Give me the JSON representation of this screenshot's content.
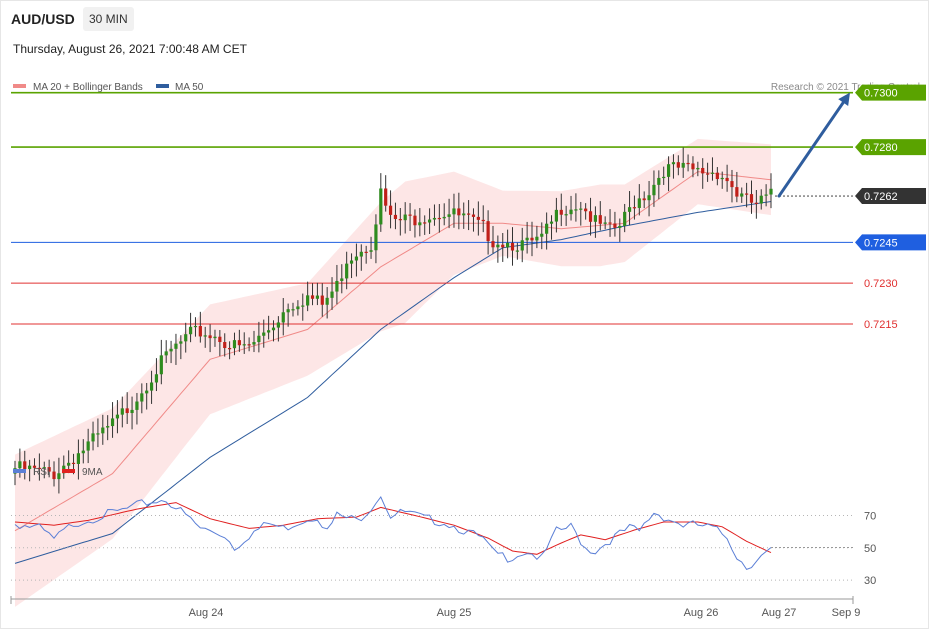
{
  "header": {
    "symbol": "AUD/USD",
    "timeframe": "30 MIN",
    "datetime": "Thursday, August 26, 2021 7:00:48 AM CET",
    "credit": "Research © 2021 Trading Central"
  },
  "legend_main": [
    {
      "label": "MA 20 + Bollinger Bands",
      "color": "#f08a88"
    },
    {
      "label": "MA 50",
      "color": "#2f5d9e"
    }
  ],
  "legend_rsi": [
    {
      "label": "RSI",
      "color": "#5b7fd6"
    },
    {
      "label": "9MA",
      "color": "#e02020"
    }
  ],
  "colors": {
    "resistance": "#5aa300",
    "current": "#333333",
    "pivot": "#1f5fe0",
    "support": "#e03030",
    "bull_candle": "#2e8b1e",
    "bear_candle": "#c0201a",
    "band_fill": "#fde3e3",
    "arrow": "#2f5d9e"
  },
  "chart_data": [
    {
      "type": "candlestick",
      "title": "AUD/USD 30 MIN",
      "ylim": [
        0.7165,
        0.7312
      ],
      "x_ticks": [
        "Aug 24",
        "Aug 25",
        "Aug 26",
        "Aug 27",
        "Sep 9"
      ],
      "levels": [
        {
          "value": 0.73,
          "label": "0.7300",
          "kind": "resistance"
        },
        {
          "value": 0.728,
          "label": "0.7280",
          "kind": "resistance"
        },
        {
          "value": 0.7262,
          "label": "0.7262",
          "kind": "current"
        },
        {
          "value": 0.7245,
          "label": "0.7245",
          "kind": "pivot"
        },
        {
          "value": 0.723,
          "label": "0.7230",
          "kind": "support"
        },
        {
          "value": 0.7215,
          "label": "0.7215",
          "kind": "support"
        }
      ],
      "close_anchors": [
        [
          0,
          0.7162
        ],
        [
          4,
          0.7161
        ],
        [
          8,
          0.716
        ],
        [
          12,
          0.7166
        ],
        [
          16,
          0.7172
        ],
        [
          20,
          0.7178
        ],
        [
          24,
          0.7186
        ],
        [
          28,
          0.7196
        ],
        [
          32,
          0.7205
        ],
        [
          36,
          0.7211
        ],
        [
          38,
          0.7212
        ],
        [
          42,
          0.721
        ],
        [
          44,
          0.7207
        ],
        [
          47,
          0.7206
        ],
        [
          49,
          0.7208
        ],
        [
          53,
          0.7215
        ],
        [
          56,
          0.7222
        ],
        [
          60,
          0.7225
        ],
        [
          63,
          0.7222
        ],
        [
          66,
          0.7229
        ],
        [
          68,
          0.7239
        ],
        [
          71,
          0.7243
        ],
        [
          73,
          0.7245
        ],
        [
          75,
          0.7263
        ],
        [
          77,
          0.7253
        ],
        [
          80,
          0.7253
        ],
        [
          84,
          0.7255
        ],
        [
          88,
          0.7256
        ],
        [
          92,
          0.7254
        ],
        [
          96,
          0.725
        ],
        [
          98,
          0.7246
        ],
        [
          101,
          0.7245
        ],
        [
          105,
          0.7244
        ],
        [
          108,
          0.7246
        ],
        [
          112,
          0.7258
        ],
        [
          116,
          0.7259
        ],
        [
          119,
          0.7252
        ],
        [
          122,
          0.7249
        ],
        [
          124,
          0.7251
        ],
        [
          127,
          0.726
        ],
        [
          130,
          0.7264
        ],
        [
          133,
          0.7272
        ],
        [
          136,
          0.7272
        ],
        [
          140,
          0.7271
        ],
        [
          144,
          0.7271
        ],
        [
          146,
          0.7268
        ],
        [
          148,
          0.7263
        ],
        [
          150,
          0.726
        ],
        [
          152,
          0.7259
        ],
        [
          155,
          0.7262
        ]
      ],
      "ma20_anchors": [
        [
          0,
          0.7139
        ],
        [
          20,
          0.716
        ],
        [
          40,
          0.7202
        ],
        [
          60,
          0.7213
        ],
        [
          75,
          0.7236
        ],
        [
          90,
          0.7252
        ],
        [
          100,
          0.7252
        ],
        [
          112,
          0.725
        ],
        [
          125,
          0.7252
        ],
        [
          140,
          0.7271
        ],
        [
          155,
          0.7268
        ]
      ],
      "ma50_anchors": [
        [
          0,
          0.7127
        ],
        [
          20,
          0.7138
        ],
        [
          40,
          0.7166
        ],
        [
          60,
          0.7188
        ],
        [
          75,
          0.7213
        ],
        [
          90,
          0.7232
        ],
        [
          100,
          0.7243
        ],
        [
          112,
          0.7246
        ],
        [
          125,
          0.7251
        ],
        [
          140,
          0.7256
        ],
        [
          155,
          0.726
        ]
      ],
      "band_width_anchors": [
        [
          0,
          0.0028
        ],
        [
          20,
          0.0024
        ],
        [
          35,
          0.0021
        ],
        [
          60,
          0.0017
        ],
        [
          80,
          0.0026
        ],
        [
          100,
          0.0012
        ],
        [
          120,
          0.0015
        ],
        [
          140,
          0.0012
        ],
        [
          155,
          0.0013
        ]
      ],
      "forecast_arrow": {
        "from": 0.7262,
        "to": 0.73
      }
    },
    {
      "type": "line",
      "title": "RSI",
      "ylim": [
        22,
        92
      ],
      "y_ticks": [
        70,
        50,
        30
      ],
      "rsi_anchors": [
        [
          0,
          65
        ],
        [
          5,
          62
        ],
        [
          8,
          55
        ],
        [
          12,
          65
        ],
        [
          18,
          70
        ],
        [
          22,
          73
        ],
        [
          27,
          78
        ],
        [
          31,
          80
        ],
        [
          35,
          70
        ],
        [
          38,
          62
        ],
        [
          43,
          58
        ],
        [
          45,
          50
        ],
        [
          48,
          58
        ],
        [
          52,
          65
        ],
        [
          55,
          62
        ],
        [
          58,
          66
        ],
        [
          62,
          70
        ],
        [
          64,
          60
        ],
        [
          66,
          70
        ],
        [
          70,
          67
        ],
        [
          72,
          72
        ],
        [
          75,
          83
        ],
        [
          77,
          70
        ],
        [
          80,
          72
        ],
        [
          84,
          68
        ],
        [
          88,
          66
        ],
        [
          92,
          61
        ],
        [
          96,
          55
        ],
        [
          98,
          47
        ],
        [
          101,
          44
        ],
        [
          105,
          48
        ],
        [
          108,
          43
        ],
        [
          111,
          60
        ],
        [
          114,
          63
        ],
        [
          117,
          50
        ],
        [
          119,
          48
        ],
        [
          122,
          55
        ],
        [
          126,
          62
        ],
        [
          128,
          60
        ],
        [
          131,
          72
        ],
        [
          134,
          68
        ],
        [
          137,
          64
        ],
        [
          140,
          64
        ],
        [
          143,
          62
        ],
        [
          146,
          57
        ],
        [
          148,
          45
        ],
        [
          150,
          38
        ],
        [
          152,
          43
        ],
        [
          155,
          48
        ]
      ],
      "ma_anchors": [
        [
          0,
          66
        ],
        [
          8,
          64
        ],
        [
          15,
          67
        ],
        [
          25,
          74
        ],
        [
          33,
          78
        ],
        [
          40,
          68
        ],
        [
          48,
          62
        ],
        [
          55,
          64
        ],
        [
          62,
          68
        ],
        [
          70,
          69
        ],
        [
          75,
          75
        ],
        [
          82,
          70
        ],
        [
          90,
          64
        ],
        [
          97,
          56
        ],
        [
          102,
          48
        ],
        [
          107,
          46
        ],
        [
          112,
          53
        ],
        [
          116,
          58
        ],
        [
          121,
          55
        ],
        [
          127,
          61
        ],
        [
          133,
          66
        ],
        [
          140,
          66
        ],
        [
          145,
          63
        ],
        [
          150,
          54
        ],
        [
          155,
          47
        ]
      ]
    }
  ]
}
